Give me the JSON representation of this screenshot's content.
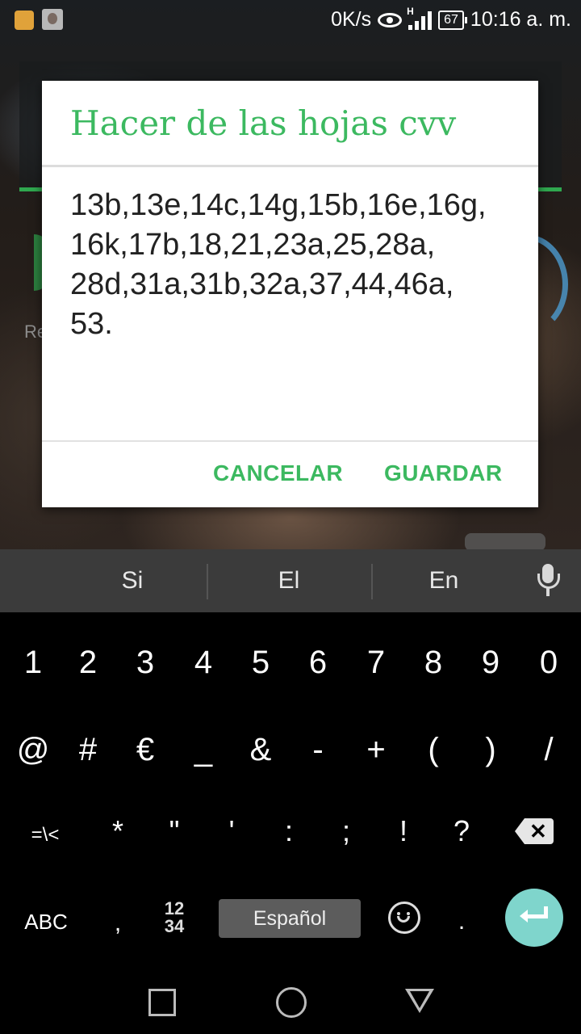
{
  "status_bar": {
    "speed": "0K/s",
    "network_type": "H",
    "battery": "67",
    "time": "10:16 a. m."
  },
  "background": {
    "partial_label": "Re"
  },
  "dialog": {
    "title": "Hacer de las hojas cvv",
    "content": "13b,13e,14c,14g,15b,16e,16g,\n16k,17b,18,21,23a,25,28a,\n28d,31a,31b,32a,37,44,46a,\n53.",
    "cancel_label": "CANCELAR",
    "save_label": "GUARDAR"
  },
  "suggestions": [
    "Si",
    "El",
    "En"
  ],
  "keyboard": {
    "row1": [
      "1",
      "2",
      "3",
      "4",
      "5",
      "6",
      "7",
      "8",
      "9",
      "0"
    ],
    "row2": [
      "@",
      "#",
      "€",
      "_",
      "&",
      "-",
      "+",
      "(",
      ")",
      "/"
    ],
    "row3": [
      "=\\<",
      "*",
      "\"",
      "'",
      ":",
      ";",
      "!",
      "?"
    ],
    "abc_label": "ABC",
    "comma": ",",
    "numpad_top": "12",
    "numpad_bottom": "34",
    "space_label": "Español",
    "period": "."
  },
  "colors": {
    "accent": "#3cb960",
    "enter_key": "#7fd5cc",
    "keyboard_bg": "#000000",
    "suggestion_bg": "#3b3b3b"
  },
  "icons": [
    "keyboard-notification-icon",
    "avatar",
    "eye-icon",
    "signal-icon",
    "battery-icon",
    "mic-icon",
    "backspace-icon",
    "emoji-icon",
    "enter-icon",
    "recent-apps-icon",
    "home-icon",
    "back-icon"
  ]
}
